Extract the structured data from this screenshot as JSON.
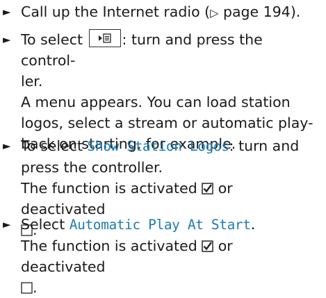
{
  "steps": [
    {
      "pre": "Call up the Internet radio (",
      "ref_icon": "page-reference-arrow-icon",
      "ref_glyph": "▷",
      "ref_text": " page 194)."
    },
    {
      "pre": "To select ",
      "icon": "play-list-menu-icon",
      "line1_post": ": turn and press the control-",
      "line2": "ler.",
      "result_lines": [
        "A menu appears. You can load station",
        "logos, select a stream or automatic play-",
        "back on starting, for example."
      ]
    },
    {
      "pre": "To select ",
      "term": "Show Station Logos",
      "line1_post": ": turn and",
      "line2": "press the controller.",
      "result_pre": "The function is activated ",
      "result_mid": " or deactivated",
      "result_end": "."
    },
    {
      "pre": "Select ",
      "term": "Automatic Play At Start",
      "post": ".",
      "result_pre": "The function is activated ",
      "result_mid": " or deactivated",
      "result_end": "."
    }
  ],
  "bullet_glyph": "►",
  "colors": {
    "ui_term": "#1e7ab3",
    "text": "#1a1a1a"
  },
  "icons": {
    "bullet": "triangle-bullet-icon",
    "checked": "checked-box-icon",
    "unchecked": "empty-box-icon"
  }
}
